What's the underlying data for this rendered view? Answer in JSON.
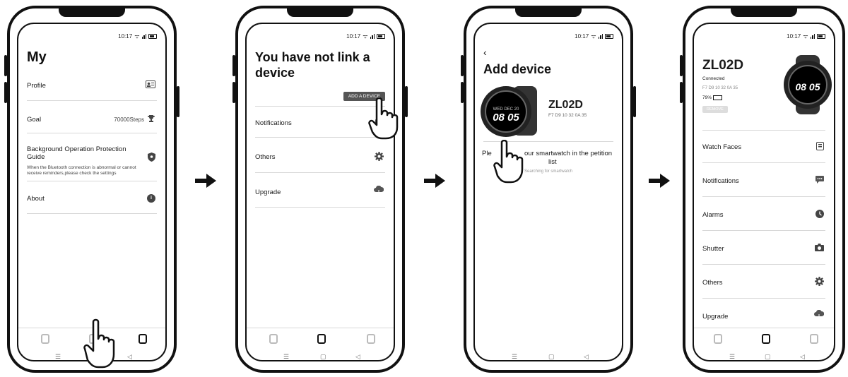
{
  "status_time": "10:17",
  "screens": {
    "my": {
      "title": "My",
      "items": [
        {
          "label": "Profile",
          "icon": "profile-card-icon"
        },
        {
          "label": "Goal",
          "value": "70000Steps",
          "icon": "trophy-icon"
        },
        {
          "label": "Background Operation Protection Guide",
          "note": "When the Bluetooth connection is abnormal or cannot receive reminders,please check the settings",
          "icon": "shield-icon"
        },
        {
          "label": "About",
          "icon": "info-icon"
        }
      ]
    },
    "no_device": {
      "title": "You have not link a device",
      "add_button": "ADD A DEVICE",
      "items": [
        {
          "label": "Notifications",
          "icon": "message-icon"
        },
        {
          "label": "Others",
          "icon": "gear-icon"
        },
        {
          "label": "Upgrade",
          "icon": "cloud-icon"
        }
      ]
    },
    "add_device": {
      "title": "Add device",
      "device_name": "ZL02D",
      "device_mac": "F7 D9 10 32 0A 35",
      "hint_left": "Ple",
      "hint_right": "our smartwatch in the petition",
      "hint_line2": "list",
      "searching": "Searching for smartwatch",
      "watch_time": "08 05",
      "watch_date": "WED DEC 20"
    },
    "device": {
      "name": "ZL02D",
      "status": "Connected",
      "mac": "F7 D9 10 32 0A 35",
      "battery": "79%",
      "remove": "REMOVE",
      "watch_time": "08 05",
      "items": [
        {
          "label": "Watch Faces",
          "icon": "watch-face-icon"
        },
        {
          "label": "Notifications",
          "icon": "message-icon"
        },
        {
          "label": "Alarms",
          "icon": "clock-icon"
        },
        {
          "label": "Shutter",
          "icon": "camera-icon"
        },
        {
          "label": "Others",
          "icon": "gear-icon"
        },
        {
          "label": "Upgrade",
          "icon": "cloud-icon"
        }
      ]
    }
  },
  "system_nav": {
    "menu": "☰",
    "home": "▢",
    "back": "◁"
  }
}
